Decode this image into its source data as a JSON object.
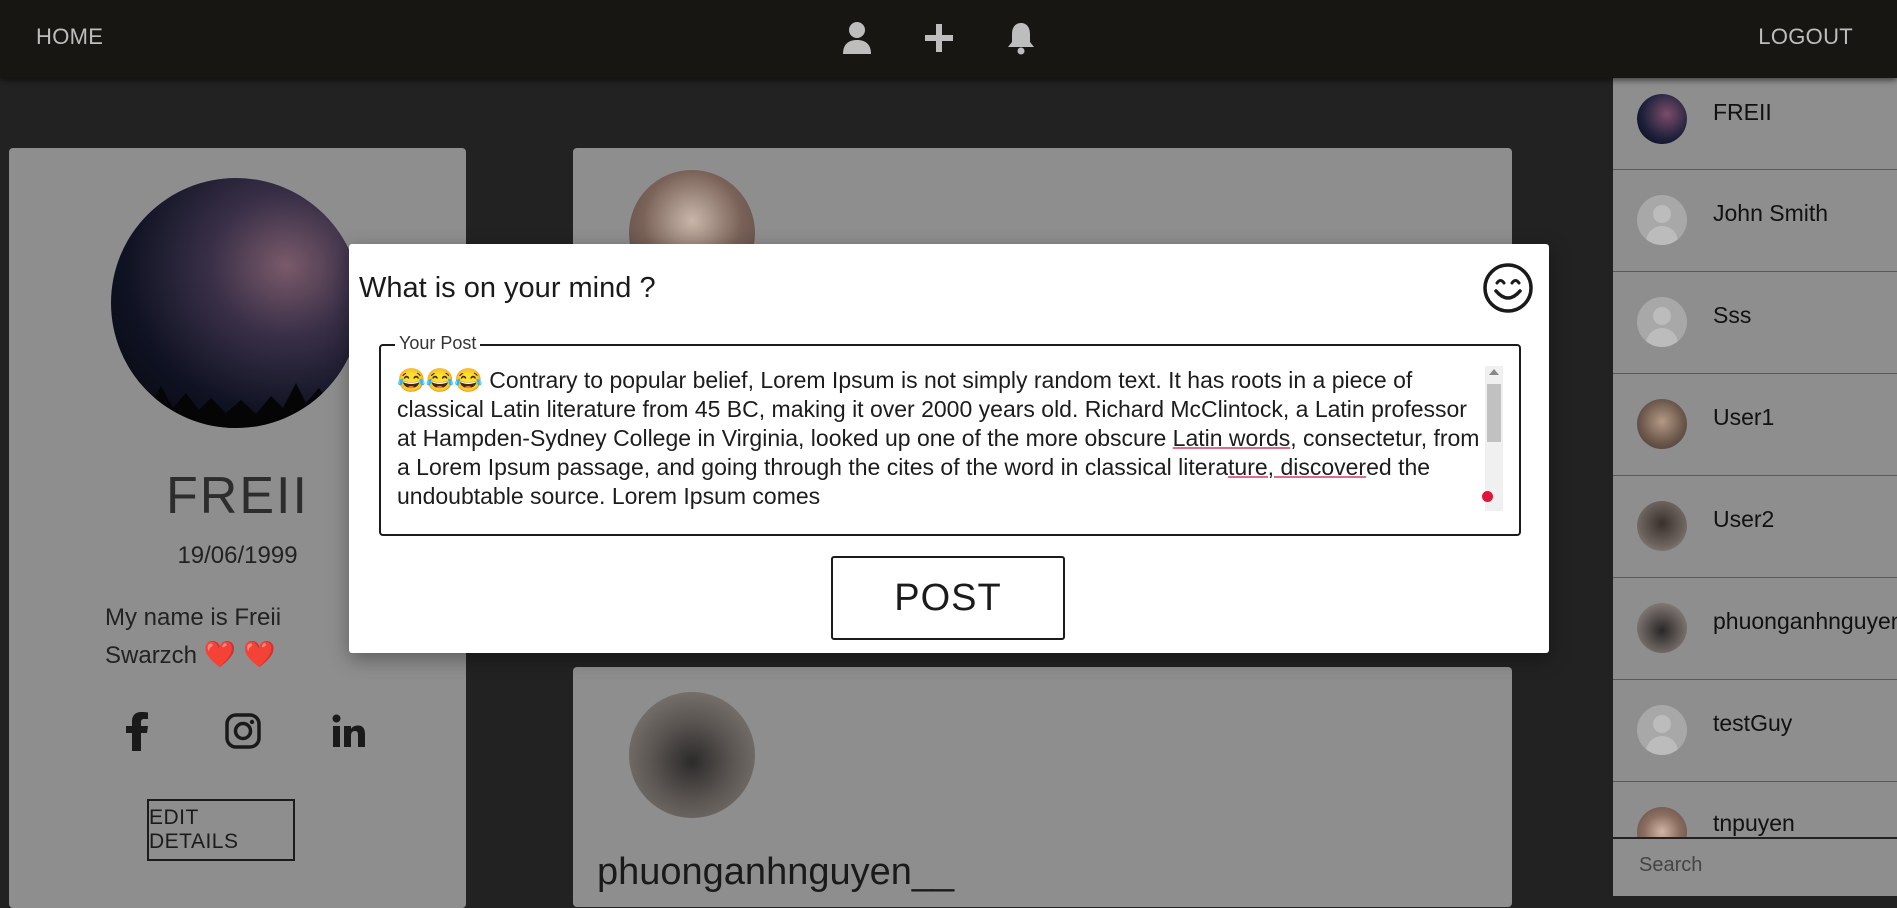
{
  "topbar": {
    "home_label": "HOME",
    "logout_label": "LOGOUT",
    "icons": [
      "user-icon",
      "plus-icon",
      "bell-icon"
    ]
  },
  "profile": {
    "name": "FREII",
    "dob": "19/06/1999",
    "bio_line1": "My name is Freii",
    "bio_line2": "Swarzch",
    "hearts": "❤️ ❤️",
    "socials": [
      "facebook-icon",
      "instagram-icon",
      "linkedin-icon"
    ],
    "edit_label": "EDIT DETAILS"
  },
  "feed": {
    "post2_user": "phuonganhnguyen__"
  },
  "sidebar": {
    "users": [
      {
        "name": "FREII"
      },
      {
        "name": "John Smith"
      },
      {
        "name": "Sss"
      },
      {
        "name": "User1"
      },
      {
        "name": "User2"
      },
      {
        "name": "phuonganhnguyen__"
      },
      {
        "name": "testGuy"
      },
      {
        "name": "tnpuyen"
      }
    ],
    "search_placeholder": "Search"
  },
  "modal": {
    "title": "What is on your mind ?",
    "field_label": "Your Post",
    "post_emojis": "😂😂😂",
    "post_text_1": " Contrary to popular belief, Lorem Ipsum is not simply random text. It has roots in a piece of classical Latin literature from 45 BC, making it over 2000 years old. Richard McClintock, a Latin professor at Hampden-Sydney College in Virginia, looked up one of the more obscure ",
    "post_text_2": "Latin words",
    "post_text_3": ", consectetur, from a Lorem Ipsum passage, and going through the cites of the word in classical litera",
    "post_text_4": "ture, discover",
    "post_text_5": "ed the undoubtable source. Lorem Ipsum comes",
    "post_button": "POST"
  },
  "colors": {
    "topbar_bg": "#171613",
    "overlay_panel": "#8e8e8e",
    "accent_caret": "#e0143c"
  }
}
